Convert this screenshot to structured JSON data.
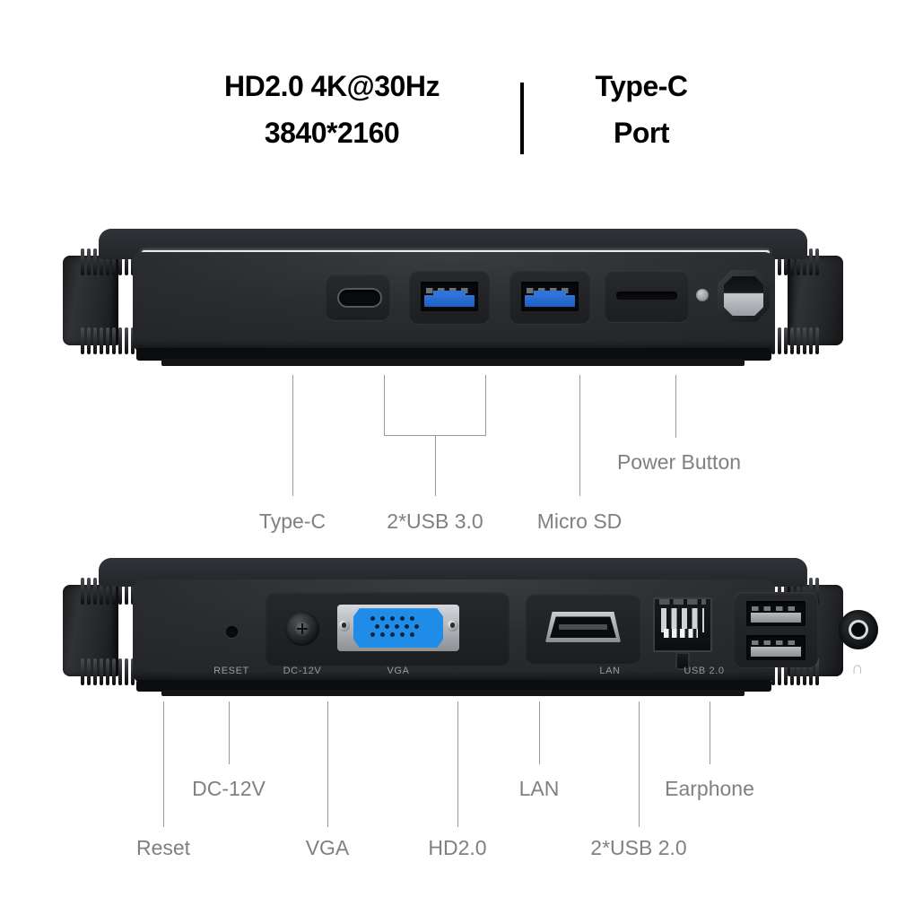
{
  "header": {
    "left_line1": "HD2.0 4K@30Hz",
    "left_line2": "3840*2160",
    "right_line1": "Type-C",
    "right_line2": "Port",
    "divider": "vertical-divider"
  },
  "front_panel": {
    "name": "front-panel",
    "ports": [
      {
        "id": "type-c",
        "icon": "usb-type-c-icon"
      },
      {
        "id": "usb3-1",
        "icon": "usb-a-blue-icon"
      },
      {
        "id": "usb3-2",
        "icon": "usb-a-blue-icon"
      },
      {
        "id": "micro-sd",
        "icon": "micro-sd-slot-icon"
      },
      {
        "id": "led",
        "icon": "led-indicator-icon"
      },
      {
        "id": "power",
        "icon": "power-button-icon"
      }
    ],
    "callouts": [
      {
        "label": "Type-C",
        "name": "callout-type-c"
      },
      {
        "label": "2*USB 3.0",
        "name": "callout-usb30"
      },
      {
        "label": "Micro SD",
        "name": "callout-micro-sd"
      },
      {
        "label": "Power Button",
        "name": "callout-power-button"
      }
    ]
  },
  "rear_panel": {
    "name": "rear-panel",
    "silkscreen": [
      {
        "text": "RESET",
        "name": "silk-reset"
      },
      {
        "text": "DC-12V",
        "name": "silk-dc12v"
      },
      {
        "text": "VGA",
        "name": "silk-vga"
      },
      {
        "text": "LAN",
        "name": "silk-lan"
      },
      {
        "text": "USB 2.0",
        "name": "silk-usb20"
      },
      {
        "text": "∩",
        "name": "silk-earphone-icon"
      }
    ],
    "ports": [
      {
        "id": "reset",
        "icon": "reset-pinhole-icon"
      },
      {
        "id": "dc-12v",
        "icon": "dc-power-jack-icon"
      },
      {
        "id": "vga",
        "icon": "vga-db15-icon"
      },
      {
        "id": "hdmi",
        "icon": "hdmi-port-icon"
      },
      {
        "id": "lan",
        "icon": "rj45-lan-icon"
      },
      {
        "id": "usb2-1",
        "icon": "usb-a-icon"
      },
      {
        "id": "usb2-2",
        "icon": "usb-a-icon"
      },
      {
        "id": "earphone",
        "icon": "audio-jack-icon"
      }
    ],
    "callouts": [
      {
        "label": "Reset",
        "name": "callout-reset"
      },
      {
        "label": "DC-12V",
        "name": "callout-dc12v"
      },
      {
        "label": "VGA",
        "name": "callout-vga"
      },
      {
        "label": "HD2.0",
        "name": "callout-hd20"
      },
      {
        "label": "LAN",
        "name": "callout-lan"
      },
      {
        "label": "2*USB 2.0",
        "name": "callout-usb20"
      },
      {
        "label": "Earphone",
        "name": "callout-earphone"
      }
    ]
  },
  "colors": {
    "background": "#ffffff",
    "text": "#000000",
    "callout_text": "#808080",
    "leader_line": "#9a9a9a",
    "usb3_blue": "#2f74d8",
    "vga_blue": "#1f8de8",
    "chassis_dark": "#1d1f22",
    "silkscreen": "#9b9ea2"
  }
}
